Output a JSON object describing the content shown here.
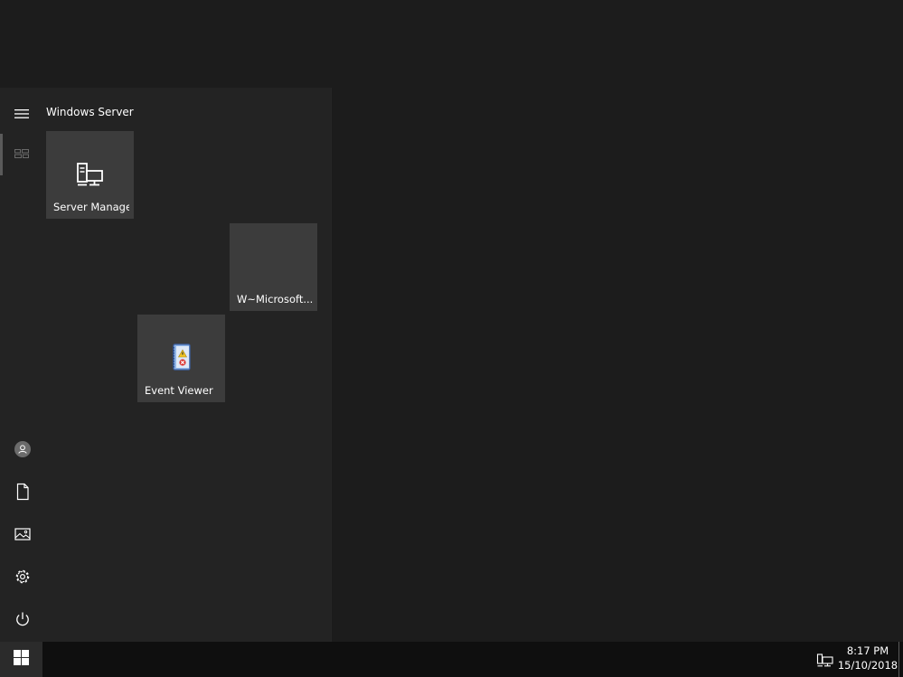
{
  "start_menu": {
    "group_title": "Windows Server",
    "tiles": [
      {
        "label": "Server Manager",
        "icon": "server-manager-icon"
      },
      {
        "label": "W~Microsoft....",
        "icon": ""
      },
      {
        "label": "Event Viewer",
        "icon": "event-viewer-icon"
      }
    ],
    "rail_icons": [
      "hamburger-menu-icon",
      "tiles-icon",
      "user-icon",
      "documents-icon",
      "pictures-icon",
      "settings-gear-icon",
      "power-icon"
    ]
  },
  "taskbar": {
    "start_icon": "windows-logo-icon",
    "tray_icon": "network-icon",
    "time": "8:17 PM",
    "date": "15/10/2018"
  },
  "colors": {
    "desktop_bg": "#1c1c1c",
    "start_menu_bg": "#232323",
    "tile_bg": "#3c3c3c",
    "taskbar_bg": "#0f0f0f"
  }
}
